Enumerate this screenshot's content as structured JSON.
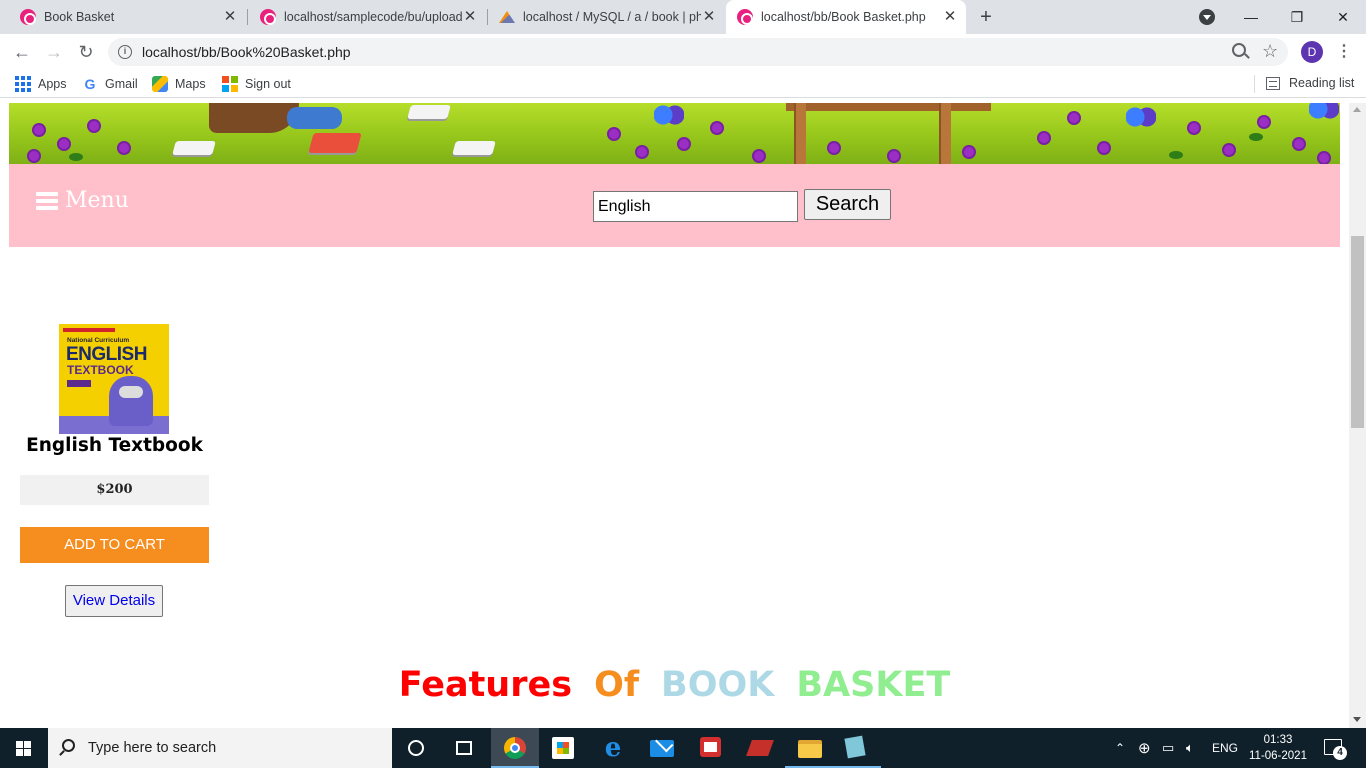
{
  "browser": {
    "tabs": [
      {
        "title": "Book Basket",
        "favicon": "wamp-icon",
        "active": false
      },
      {
        "title": "localhost/samplecode/bu/upload",
        "favicon": "wamp-icon",
        "active": false
      },
      {
        "title": "localhost / MySQL / a / book | ph",
        "favicon": "phpmyadmin-icon",
        "active": false
      },
      {
        "title": "localhost/bb/Book Basket.php",
        "favicon": "wamp-icon",
        "active": true
      }
    ],
    "new_tab_glyph": "+",
    "close_glyph": "✕",
    "window_controls": {
      "minimize": "—",
      "maximize": "❐",
      "close": "✕"
    },
    "url": "localhost/bb/Book%20Basket.php",
    "profile_initial": "D",
    "bookmarks": [
      {
        "label": "Apps",
        "icon": "apps-grid-icon"
      },
      {
        "label": "Gmail",
        "icon": "google-icon"
      },
      {
        "label": "Maps",
        "icon": "maps-icon"
      },
      {
        "label": "Sign out",
        "icon": "microsoft-icon"
      }
    ],
    "reading_list": "Reading list"
  },
  "page": {
    "nav": {
      "menu_label": "Menu",
      "search_value": "English",
      "search_button": "Search"
    },
    "product": {
      "title": "English Textbook",
      "price": "$200",
      "add_to_cart": "ADD TO CART",
      "view_details": "View Details",
      "cover": {
        "series": "National Curriculum",
        "word1": "ENGLISH",
        "word2": "TEXTBOOK"
      }
    },
    "features_heading": [
      {
        "text": "Features",
        "color": "#ff0000"
      },
      {
        "text": "Of",
        "color": "#f58d1f"
      },
      {
        "text": "BOOK",
        "color": "#add8e6"
      },
      {
        "text": "BASKET",
        "color": "#90ee90"
      }
    ],
    "colors": {
      "navbar_bg": "#ffc0cb",
      "add_to_cart_bg": "#f58d1f",
      "price_bg": "#f1f1f1"
    }
  },
  "taskbar": {
    "search_placeholder": "Type here to search",
    "language": "ENG",
    "time": "01:33",
    "date": "11-06-2021",
    "notification_count": "4"
  }
}
